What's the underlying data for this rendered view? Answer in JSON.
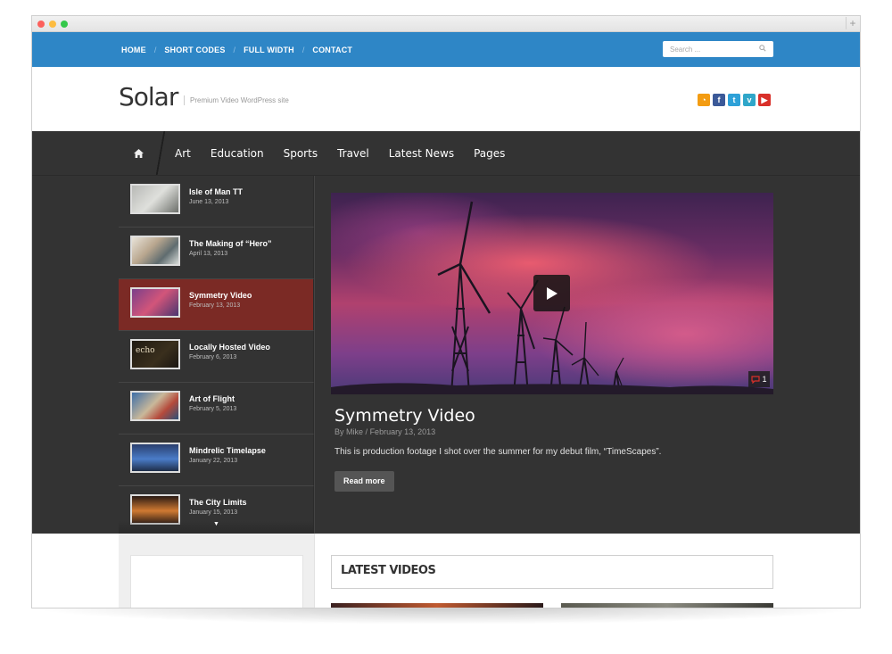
{
  "topnav": {
    "items": [
      {
        "label": "HOME"
      },
      {
        "label": "SHORT CODES"
      },
      {
        "label": "FULL WIDTH"
      },
      {
        "label": "CONTACT"
      }
    ],
    "separator": "/"
  },
  "search": {
    "placeholder": "Search ...",
    "icon": "search-icon"
  },
  "header": {
    "logo": "Solar",
    "tagline": "Premium Video WordPress site",
    "socials": [
      {
        "name": "rss-icon",
        "glyph": "◔",
        "color": "#f39c12"
      },
      {
        "name": "facebook-icon",
        "glyph": "f",
        "color": "#3b5998"
      },
      {
        "name": "twitter-icon",
        "glyph": "t",
        "color": "#2ea1d8"
      },
      {
        "name": "vimeo-icon",
        "glyph": "v",
        "color": "#2fa6c9"
      },
      {
        "name": "youtube-icon",
        "glyph": "▶",
        "color": "#d9302a"
      }
    ]
  },
  "mainnav": {
    "home_icon": "home-icon",
    "items": [
      {
        "label": "Art"
      },
      {
        "label": "Education"
      },
      {
        "label": "Sports"
      },
      {
        "label": "Travel"
      },
      {
        "label": "Latest News"
      },
      {
        "label": "Pages"
      }
    ]
  },
  "videos": [
    {
      "title": "Isle of Man TT",
      "date": "June 13, 2013",
      "thumb": "linear-gradient(135deg,#b8b9b6,#dfe0dc 50%,#6c6f6a)"
    },
    {
      "title": "The Making of “Hero”",
      "date": "April 13, 2013",
      "thumb": "linear-gradient(135deg,#e9e4da,#b9a78f 40%,#5f6c6f 70%,#d7dbd8)"
    },
    {
      "title": "Symmetry Video",
      "date": "February 13, 2013",
      "thumb": "linear-gradient(135deg,#7a3f8a,#d2557a 50%,#4a3570)",
      "active": true
    },
    {
      "title": "Locally Hosted Video",
      "date": "February 6, 2013",
      "thumb": "linear-gradient(135deg,#1f1a12,#3a2f1d 60%,#1a1611)",
      "thumb_text": "echo"
    },
    {
      "title": "Art of Flight",
      "date": "February 5, 2013",
      "thumb": "linear-gradient(135deg,#3c6ea8,#c9b89a 45%,#b54a3b 70%,#2a4f78)"
    },
    {
      "title": "Mindrelic Timelapse",
      "date": "January 22, 2013",
      "thumb": "linear-gradient(180deg,#2a3f6e,#4a7cc8 55%,#1e2d48)"
    },
    {
      "title": "The City Limits",
      "date": "January 15, 2013",
      "thumb": "linear-gradient(180deg,#2a1a14,#d07a32 55%,#3a2418)"
    }
  ],
  "featured": {
    "title": "Symmetry Video",
    "author": "By Mike",
    "date": "February 13, 2013",
    "meta_sep": "/",
    "excerpt": "This is production footage I shot over the summer for my debut film, “TimeScapes”.",
    "read_more": "Read more",
    "comment_count": "1",
    "play_icon": "play-icon"
  },
  "lower": {
    "latest_title": "LATEST VIDEOS"
  },
  "colors": {
    "topbar": "#2e86c6",
    "dark": "#333333",
    "active_item": "#7b2a25"
  }
}
